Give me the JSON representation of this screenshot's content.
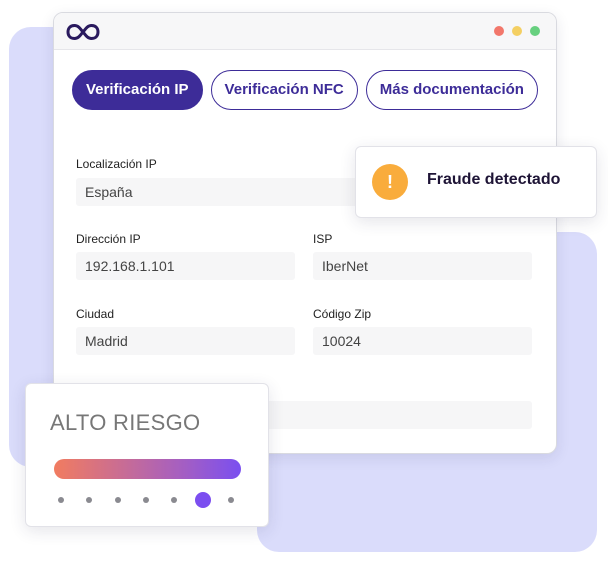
{
  "window": {
    "logo_icon": "infinity-logo-icon",
    "traffic_lights": [
      "#f2776b",
      "#f4cf62",
      "#67d07f"
    ]
  },
  "tabs": [
    {
      "label": "Verificación IP",
      "active": true
    },
    {
      "label": "Verificación NFC",
      "active": false
    },
    {
      "label": "Más documentación",
      "active": false
    }
  ],
  "form": {
    "location_label": "Localización IP",
    "location_value": "España",
    "ip_label": "Dirección IP",
    "ip_value": "192.168.1.101",
    "isp_label": "ISP",
    "isp_value": "IberNet",
    "city_label": "Ciudad",
    "city_value": "Madrid",
    "zip_label": "Código Zip",
    "zip_value": "10024"
  },
  "alert": {
    "icon": "warning-icon",
    "icon_glyph": "!",
    "text": "Fraude detectado",
    "icon_color": "#f9ac3c"
  },
  "risk": {
    "title": "ALTO RIESGO",
    "level_index": 5,
    "level_count": 7,
    "accent": "#7c4ef0"
  },
  "colors": {
    "brand": "#3d2c98",
    "background_accent": "#dadcfb"
  }
}
